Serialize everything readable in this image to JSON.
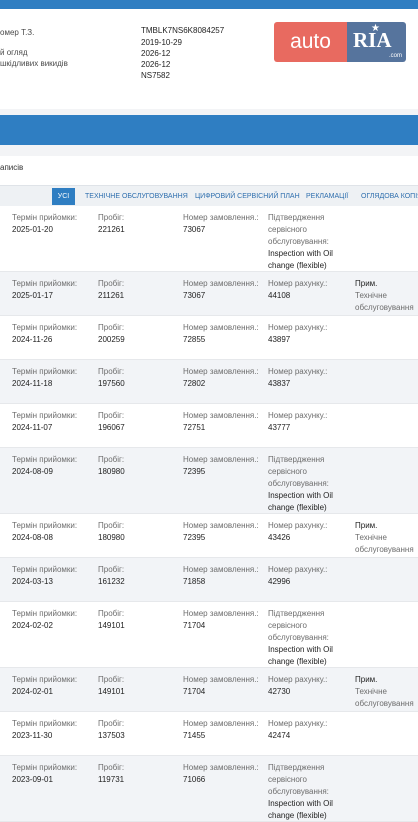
{
  "vehicle_info": {
    "rows": [
      {
        "label": "омер Т.З.",
        "value": "TMBLK7NS6K8084257"
      },
      {
        "label": "",
        "value": "2019-10-29"
      },
      {
        "label": "й огляд",
        "value": "2026-12"
      },
      {
        "label": "шкідливих викидів",
        "value": "2026-12"
      },
      {
        "label": "",
        "value": "NS7582"
      }
    ]
  },
  "logo": {
    "auto": "auto",
    "ria": "RIA",
    "com": ".com"
  },
  "records_text": "аписів",
  "tabs": [
    {
      "label": "УСІ",
      "active": true
    },
    {
      "label": "ТЕХНІЧНЕ ОБСЛУГОВУВАННЯ",
      "active": false
    },
    {
      "label": "ЦИФРОВИЙ СЕРВІСНИЙ ПЛАН",
      "active": false
    },
    {
      "label": "РЕКЛАМАЦІЇ",
      "active": false
    },
    {
      "label": "ОГЛЯДОВА КОПІЯ",
      "active": false
    }
  ],
  "labels": {
    "date": "Термін прийомки:",
    "mileage": "Пробіг:",
    "order": "Номер замовлення.:",
    "invoice": "Номер рахунку.:",
    "confirm": "Підтвердження сервісного обслуговування:",
    "note": "Прим.",
    "note_value": "Технічне обслуговування"
  },
  "entries": [
    {
      "date": "2025-01-20",
      "mileage": "221261",
      "order": "73067",
      "type": "confirm",
      "detail": "Inspection with Oil change (flexible)",
      "note": false
    },
    {
      "date": "2025-01-17",
      "mileage": "211261",
      "order": "73067",
      "type": "invoice",
      "detail": "44108",
      "note": true
    },
    {
      "date": "2024-11-26",
      "mileage": "200259",
      "order": "72855",
      "type": "invoice",
      "detail": "43897",
      "note": false
    },
    {
      "date": "2024-11-18",
      "mileage": "197560",
      "order": "72802",
      "type": "invoice",
      "detail": "43837",
      "note": false
    },
    {
      "date": "2024-11-07",
      "mileage": "196067",
      "order": "72751",
      "type": "invoice",
      "detail": "43777",
      "note": false
    },
    {
      "date": "2024-08-09",
      "mileage": "180980",
      "order": "72395",
      "type": "confirm",
      "detail": "Inspection with Oil change (flexible)",
      "note": false
    },
    {
      "date": "2024-08-08",
      "mileage": "180980",
      "order": "72395",
      "type": "invoice",
      "detail": "43426",
      "note": true
    },
    {
      "date": "2024-03-13",
      "mileage": "161232",
      "order": "71858",
      "type": "invoice",
      "detail": "42996",
      "note": false
    },
    {
      "date": "2024-02-02",
      "mileage": "149101",
      "order": "71704",
      "type": "confirm",
      "detail": "Inspection with Oil change (flexible)",
      "note": false
    },
    {
      "date": "2024-02-01",
      "mileage": "149101",
      "order": "71704",
      "type": "invoice",
      "detail": "42730",
      "note": true
    },
    {
      "date": "2023-11-30",
      "mileage": "137503",
      "order": "71455",
      "type": "invoice",
      "detail": "42474",
      "note": false
    },
    {
      "date": "2023-09-01",
      "mileage": "119731",
      "order": "71066",
      "type": "confirm",
      "detail": "Inspection with Oil change (flexible)",
      "note": false
    }
  ]
}
